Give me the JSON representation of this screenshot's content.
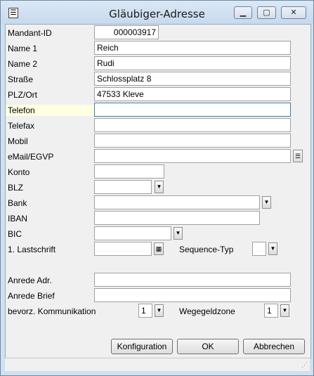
{
  "window": {
    "title": "Gläubiger-Adresse",
    "minimize": "▁",
    "maximize": "▢",
    "close": "✕"
  },
  "form": {
    "mandant_id": {
      "label": "Mandant-ID",
      "value": "000003917"
    },
    "name1": {
      "label": "Name 1",
      "value": "Reich"
    },
    "name2": {
      "label": "Name 2",
      "value": "Rudi"
    },
    "strasse": {
      "label": "Straße",
      "value": "Schlossplatz 8"
    },
    "plz_ort": {
      "label": "PLZ/Ort",
      "value": "47533 Kleve"
    },
    "telefon": {
      "label": "Telefon",
      "value": ""
    },
    "telefax": {
      "label": "Telefax",
      "value": ""
    },
    "mobil": {
      "label": "Mobil",
      "value": ""
    },
    "email": {
      "label": "eMail/EGVP",
      "value": ""
    },
    "konto": {
      "label": "Konto",
      "value": ""
    },
    "blz": {
      "label": "BLZ",
      "value": ""
    },
    "bank": {
      "label": "Bank",
      "value": ""
    },
    "iban": {
      "label": "IBAN",
      "value": ""
    },
    "bic": {
      "label": "BIC",
      "value": ""
    },
    "lastschrift": {
      "label": "1. Lastschrift",
      "value": ""
    },
    "sequence_typ": {
      "label": "Sequence-Typ",
      "value": ""
    },
    "anrede_adr": {
      "label": "Anrede Adr.",
      "value": ""
    },
    "anrede_brief": {
      "label": "Anrede Brief",
      "value": ""
    },
    "kommunikation": {
      "label": "bevorz. Kommunikation",
      "value": "1"
    },
    "wegegeldzone": {
      "label": "Wegegeldzone",
      "value": "1"
    }
  },
  "buttons": {
    "konfiguration": "Konfiguration",
    "ok": "OK",
    "abbrechen": "Abbrechen"
  },
  "icons": {
    "dropdown": "▼",
    "calendar": "▦",
    "email_lookup": "☰",
    "grip": "⋰"
  }
}
